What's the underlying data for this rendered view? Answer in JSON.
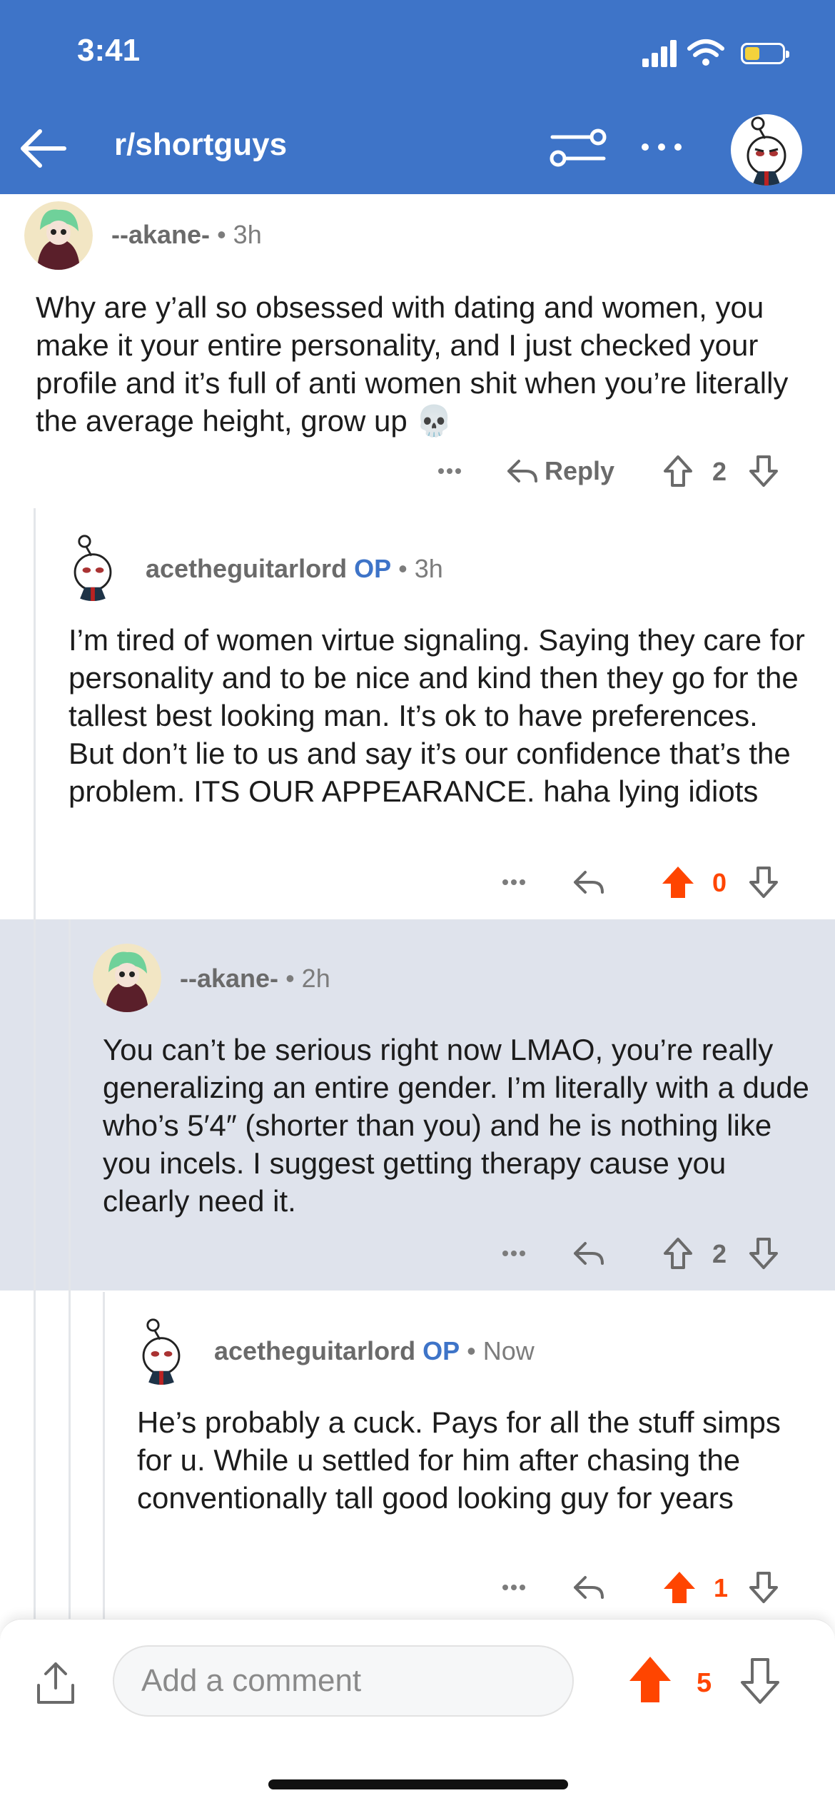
{
  "status_bar": {
    "time": "3:41"
  },
  "nav": {
    "title": "r/shortguys"
  },
  "colors": {
    "header": "#3e74c8",
    "upvote_active": "#ff4500",
    "highlight": "#dfe3ec"
  },
  "comments": [
    {
      "username": "--akane-",
      "op": "",
      "age": "3h",
      "body": "Why are y’all so obsessed with dating and women, you make it your entire personality, and I just checked your profile and it’s full of anti women shit when you’re literally the average height, grow up 💀",
      "reply_label": "Reply",
      "score": "2",
      "upvoted": false
    },
    {
      "username": "acetheguitarlord",
      "op": "OP",
      "age": "3h",
      "body": "I’m tired of women virtue signaling. Saying they care for personality and to be nice and kind then they go for the tallest best looking man. It’s ok to have preferences. But don’t lie to us and say it’s our confidence that’s the problem. ITS OUR APPEARANCE. haha lying idiots",
      "score": "0",
      "upvoted": true
    },
    {
      "username": "--akane-",
      "op": "",
      "age": "2h",
      "body": "You can’t be serious right now LMAO, you’re really generalizing an entire gender. I’m literally with a dude who’s 5′4″ (shorter than you) and he is nothing like you incels. I suggest getting therapy cause you clearly need it.",
      "score": "2",
      "upvoted": false
    },
    {
      "username": "acetheguitarlord",
      "op": "OP",
      "age": "Now",
      "body": "He’s probably a cuck. Pays for all the stuff simps for u. While u settled for him after chasing the conventionally tall good looking guy for years",
      "score": "1",
      "upvoted": true
    }
  ],
  "bottom_bar": {
    "comment_placeholder": "Add a comment",
    "post_score": "5",
    "post_upvoted": true
  },
  "icons": [
    "back-arrow-icon",
    "filter-icon",
    "more-icon",
    "share-icon",
    "upvote-icon",
    "downvote-icon",
    "reply-icon"
  ]
}
